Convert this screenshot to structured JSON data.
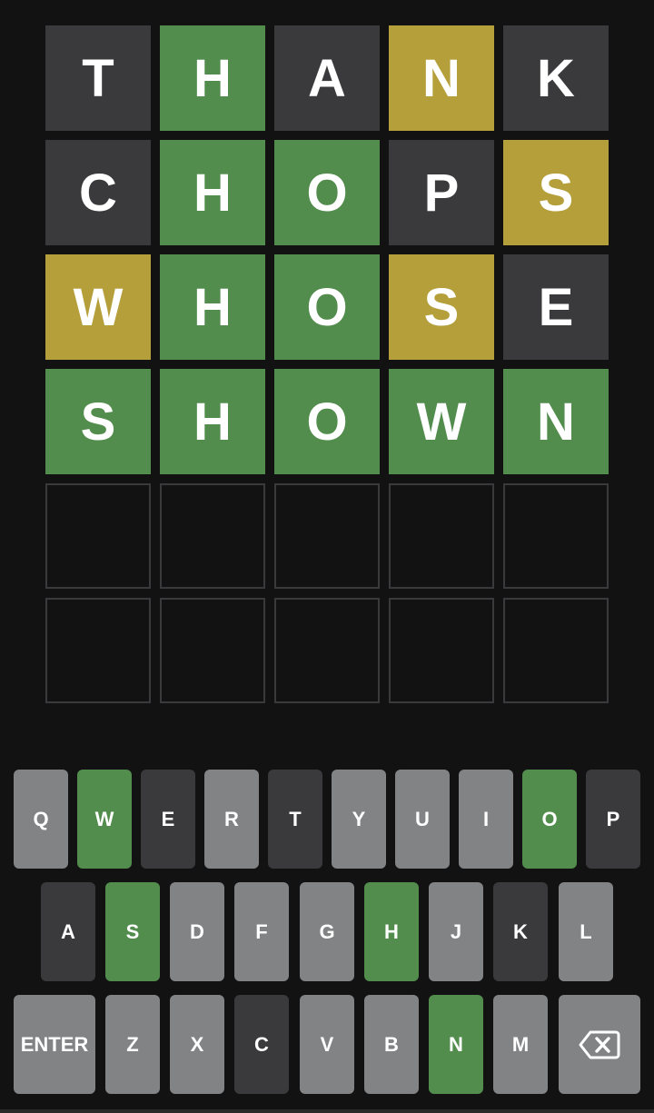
{
  "board": {
    "rows": [
      [
        {
          "letter": "T",
          "state": "absent"
        },
        {
          "letter": "H",
          "state": "correct"
        },
        {
          "letter": "A",
          "state": "absent"
        },
        {
          "letter": "N",
          "state": "present"
        },
        {
          "letter": "K",
          "state": "absent"
        }
      ],
      [
        {
          "letter": "C",
          "state": "absent"
        },
        {
          "letter": "H",
          "state": "correct"
        },
        {
          "letter": "O",
          "state": "correct"
        },
        {
          "letter": "P",
          "state": "absent"
        },
        {
          "letter": "S",
          "state": "present"
        }
      ],
      [
        {
          "letter": "W",
          "state": "present"
        },
        {
          "letter": "H",
          "state": "correct"
        },
        {
          "letter": "O",
          "state": "correct"
        },
        {
          "letter": "S",
          "state": "present"
        },
        {
          "letter": "E",
          "state": "absent"
        }
      ],
      [
        {
          "letter": "S",
          "state": "correct"
        },
        {
          "letter": "H",
          "state": "correct"
        },
        {
          "letter": "O",
          "state": "correct"
        },
        {
          "letter": "W",
          "state": "correct"
        },
        {
          "letter": "N",
          "state": "correct"
        }
      ],
      [
        {
          "letter": "",
          "state": "empty"
        },
        {
          "letter": "",
          "state": "empty"
        },
        {
          "letter": "",
          "state": "empty"
        },
        {
          "letter": "",
          "state": "empty"
        },
        {
          "letter": "",
          "state": "empty"
        }
      ],
      [
        {
          "letter": "",
          "state": "empty"
        },
        {
          "letter": "",
          "state": "empty"
        },
        {
          "letter": "",
          "state": "empty"
        },
        {
          "letter": "",
          "state": "empty"
        },
        {
          "letter": "",
          "state": "empty"
        }
      ]
    ]
  },
  "keyboard": {
    "rows": [
      [
        {
          "label": "Q",
          "state": "unused"
        },
        {
          "label": "W",
          "state": "correct"
        },
        {
          "label": "E",
          "state": "absent"
        },
        {
          "label": "R",
          "state": "unused"
        },
        {
          "label": "T",
          "state": "absent"
        },
        {
          "label": "Y",
          "state": "unused"
        },
        {
          "label": "U",
          "state": "unused"
        },
        {
          "label": "I",
          "state": "unused"
        },
        {
          "label": "O",
          "state": "correct"
        },
        {
          "label": "P",
          "state": "absent"
        }
      ],
      [
        {
          "label": "A",
          "state": "absent"
        },
        {
          "label": "S",
          "state": "correct"
        },
        {
          "label": "D",
          "state": "unused"
        },
        {
          "label": "F",
          "state": "unused"
        },
        {
          "label": "G",
          "state": "unused"
        },
        {
          "label": "H",
          "state": "correct"
        },
        {
          "label": "J",
          "state": "unused"
        },
        {
          "label": "K",
          "state": "absent"
        },
        {
          "label": "L",
          "state": "unused"
        }
      ],
      [
        {
          "label": "ENTER",
          "state": "unused",
          "kind": "enter"
        },
        {
          "label": "Z",
          "state": "unused"
        },
        {
          "label": "X",
          "state": "unused"
        },
        {
          "label": "C",
          "state": "absent"
        },
        {
          "label": "V",
          "state": "unused"
        },
        {
          "label": "B",
          "state": "unused"
        },
        {
          "label": "N",
          "state": "correct"
        },
        {
          "label": "M",
          "state": "unused"
        },
        {
          "label": "",
          "state": "unused",
          "kind": "backspace",
          "icon": "backspace-icon"
        }
      ]
    ]
  },
  "colors": {
    "background": "#121213",
    "correct": "#538d4e",
    "present": "#b59f3b",
    "absent": "#3a3a3c",
    "unused_key": "#818384",
    "empty_border": "#3a3a3c"
  }
}
